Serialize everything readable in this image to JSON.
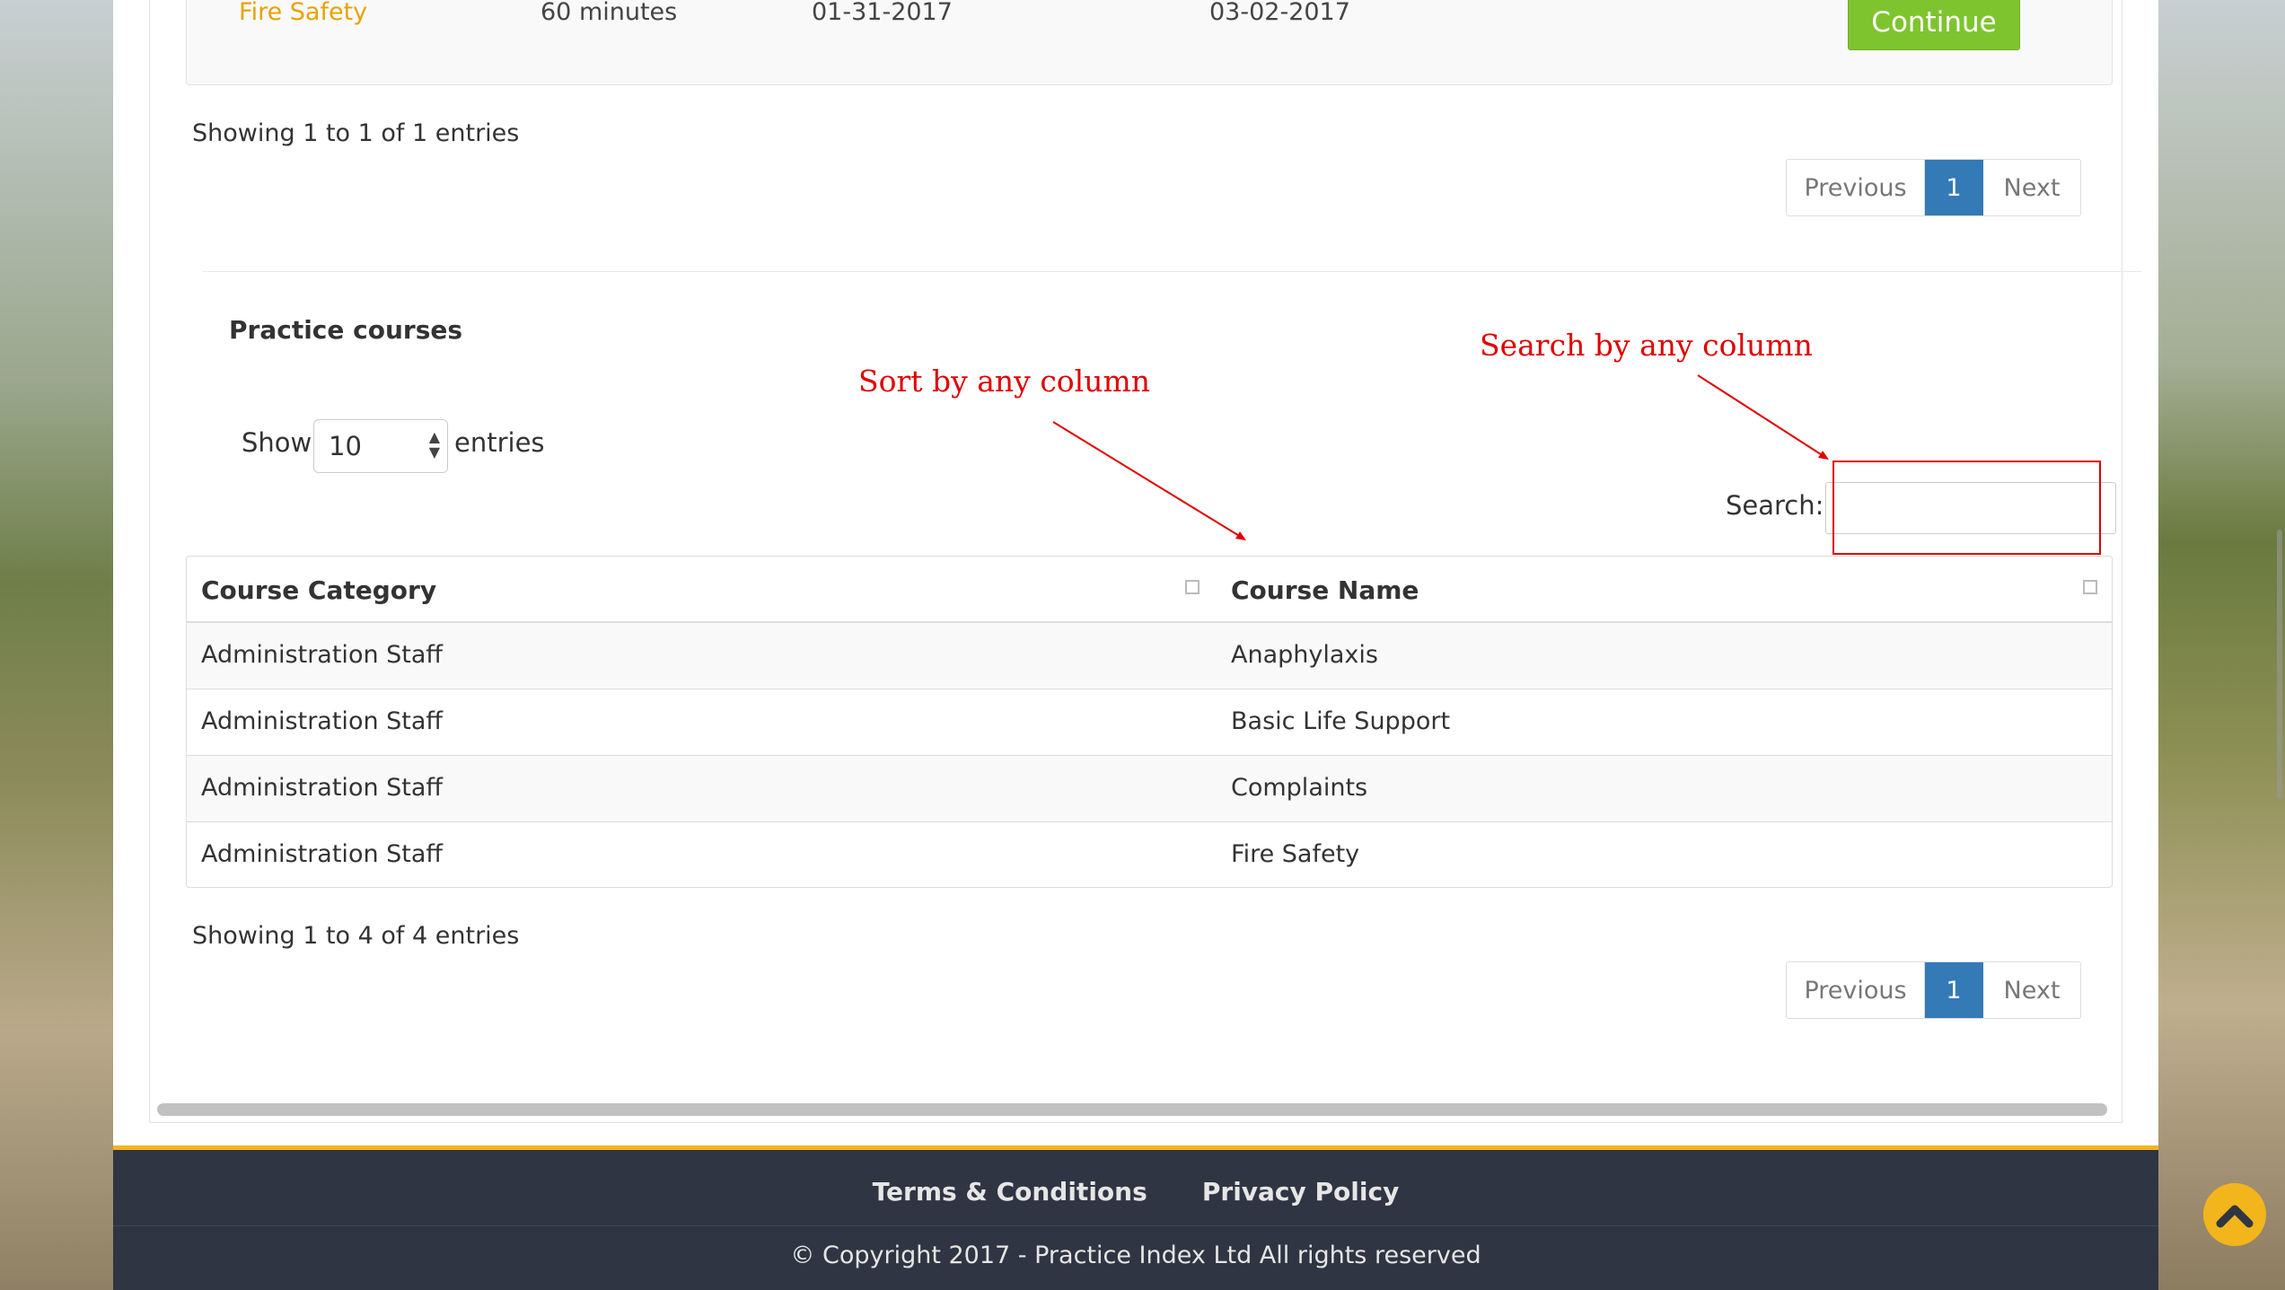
{
  "top_table": {
    "row": {
      "course_name": "Fire Safety",
      "duration": "60 minutes",
      "start_date": "01-31-2017",
      "end_date": "03-02-2017",
      "action_label": "Continue"
    },
    "info": "Showing 1 to 1 of 1 entries",
    "pagination": {
      "previous": "Previous",
      "current": "1",
      "next": "Next"
    }
  },
  "practice_courses": {
    "title": "Practice courses",
    "length": {
      "show_label": "Show",
      "selected": "10",
      "entries_label": "entries"
    },
    "search": {
      "label": "Search:",
      "value": ""
    },
    "columns": [
      "Course Category",
      "Course Name"
    ],
    "rows": [
      {
        "category": "Administration Staff",
        "name": "Anaphylaxis"
      },
      {
        "category": "Administration Staff",
        "name": "Basic Life Support"
      },
      {
        "category": "Administration Staff",
        "name": "Complaints"
      },
      {
        "category": "Administration Staff",
        "name": "Fire Safety"
      }
    ],
    "info": "Showing 1 to 4 of 4 entries",
    "pagination": {
      "previous": "Previous",
      "current": "1",
      "next": "Next"
    }
  },
  "annotations": {
    "sort": "Sort by any column",
    "search": "Search by any column"
  },
  "footer": {
    "links": [
      "Terms & Conditions",
      "Privacy Policy"
    ],
    "copyright": "© Copyright 2017 - Practice Index Ltd All rights reserved"
  },
  "colors": {
    "accent": "#337ab7",
    "continue": "#7ec42f",
    "course_highlight": "#e8a202",
    "annotation": "#e00000",
    "footer_bg": "#2f3542",
    "footer_border": "#f2b51b"
  },
  "icons": [
    "sort-icon",
    "select-arrows-icon",
    "chevron-up-icon"
  ]
}
